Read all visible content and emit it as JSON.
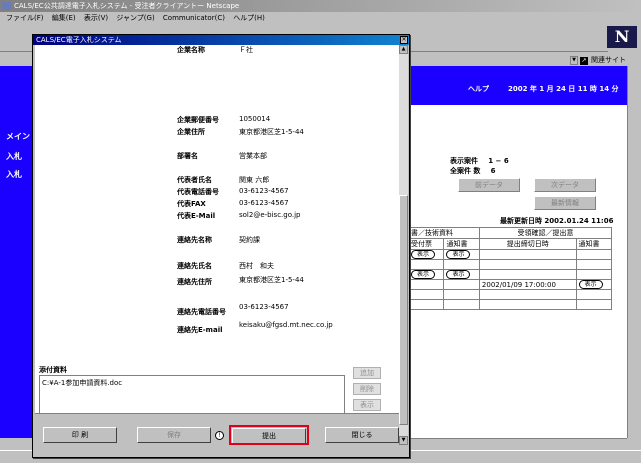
{
  "main_window": {
    "title": "CALS/EC公共調達電子入札システム - 受注者クライアントー Netscape",
    "menu": [
      "ファイル(F)",
      "編集(E)",
      "表示(V)",
      "ジャンプ(G)",
      "Communicator(C)",
      "ヘルプ(H)"
    ],
    "logo": "N",
    "location_label": "関連サイト"
  },
  "header": {
    "help": "ヘルプ",
    "date": "2002 年  1 月 24 日   11 時 14 分"
  },
  "left_nav": [
    "メイン",
    "入札",
    "入札"
  ],
  "list_info": {
    "display_label": "表示案件",
    "display_value": "1 − 6",
    "total_label": "全案件 数",
    "total_value": "6",
    "prev_button": "前データ",
    "next_button": "次データ",
    "refresh_button": "最新情報",
    "last_update": "最新更新日時 2002.01.24 11:06"
  },
  "table": {
    "header_group": "受領確認／提出意",
    "header_left": "書／技術資料",
    "col_receipt": "受付票",
    "col_notice": "通知書",
    "col_deadline": "提出締切日時",
    "col_notice2": "通知書",
    "show_label": "表示",
    "deadline_value": "2002/01/09 17:00:00"
  },
  "popup": {
    "title": "CALS/EC電子入札システム",
    "fields": [
      {
        "label": "企業名称",
        "value": "Ｆ社"
      },
      {
        "label": "企業郵便番号",
        "value": "1050014"
      },
      {
        "label": "企業住所",
        "value": "東京都港区芝1-5-44"
      },
      {
        "label": "部署名",
        "value": "営業本部"
      },
      {
        "label": "代表者氏名",
        "value": "関東 六郎"
      },
      {
        "label": "代表電話番号",
        "value": "03-6123-4567"
      },
      {
        "label": "代表FAX",
        "value": "03-6123-4567"
      },
      {
        "label": "代表E-Mail",
        "value": "sol2@e-bisc.go.jp"
      },
      {
        "label": "連絡先名称",
        "value": "契約課"
      },
      {
        "label": "連絡先氏名",
        "value": "西村　和夫"
      },
      {
        "label": "連絡先住所",
        "value": "東京都港区芝1-5-44"
      },
      {
        "label": "連絡先電話番号",
        "value": "03-6123-4567"
      },
      {
        "label": "連絡先E-mail",
        "value": "keisaku@fgsd.mt.nec.co.jp"
      }
    ],
    "attachment_label": "添付資料",
    "attachment_file": "C:¥A-1参加申請資料.doc",
    "add_button": "追加",
    "delete_button": "削除",
    "show_button": "表示",
    "print_button": "印 刷",
    "save_button": "保存",
    "submit_button": "提出",
    "close_button": "閉じる"
  }
}
